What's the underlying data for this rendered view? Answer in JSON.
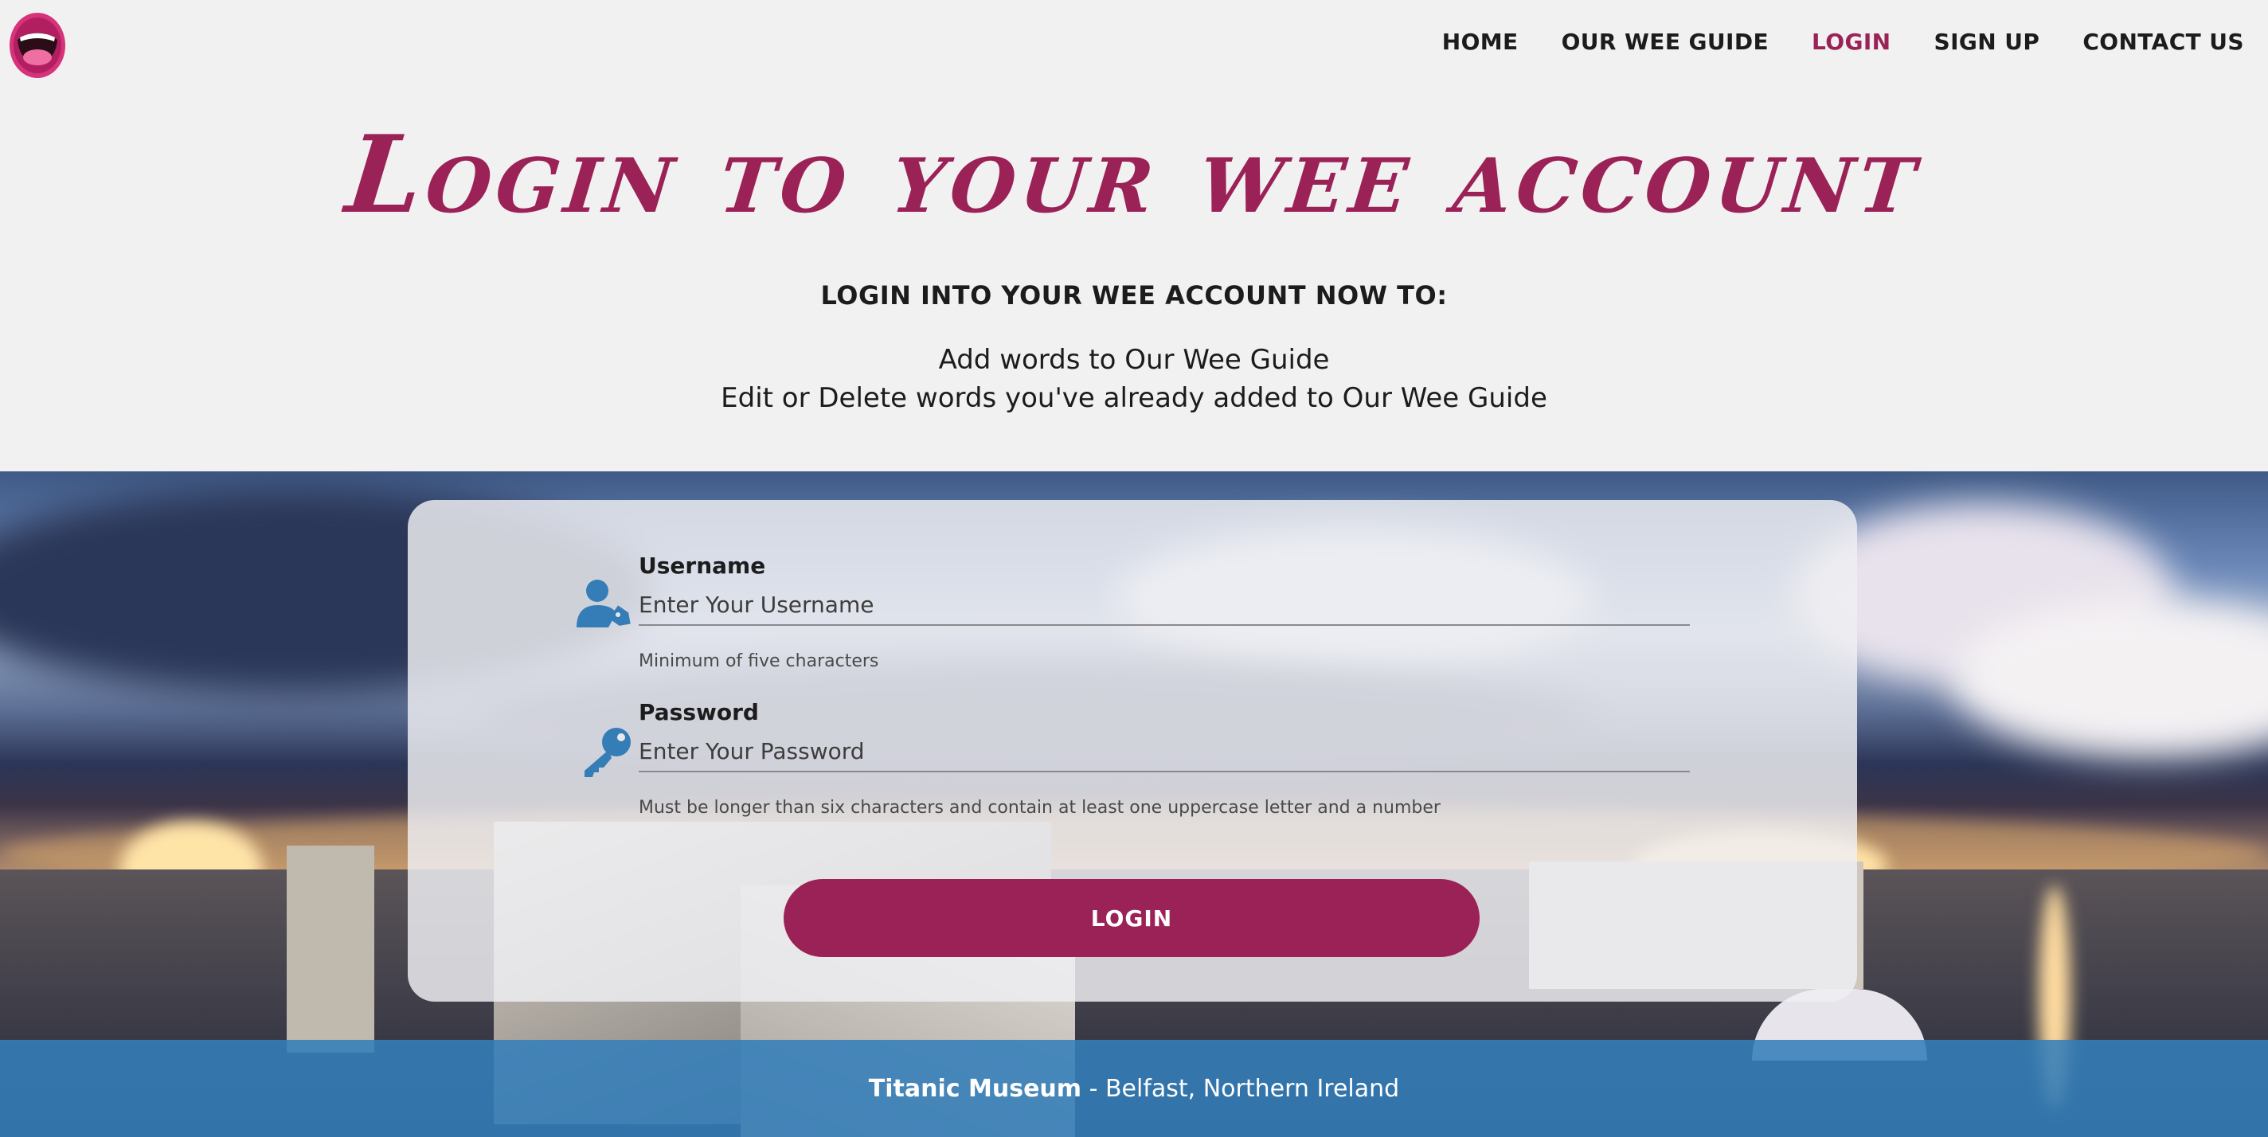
{
  "nav": {
    "items": [
      {
        "label": "HOME",
        "active": false
      },
      {
        "label": "OUR WEE GUIDE",
        "active": false
      },
      {
        "label": "LOGIN",
        "active": true
      },
      {
        "label": "SIGN UP",
        "active": false
      },
      {
        "label": "CONTACT US",
        "active": false
      }
    ]
  },
  "logo": {
    "icon": "open-mouth-logo-icon"
  },
  "intro": {
    "title": "Login to your wee account",
    "subhead": "LOGIN INTO YOUR WEE ACCOUNT NOW TO:",
    "benefits": [
      "Add words to Our Wee Guide",
      "Edit or Delete words you've already added to Our Wee Guide"
    ]
  },
  "form": {
    "username": {
      "label": "Username",
      "placeholder": "Enter Your Username",
      "value": "",
      "hint": "Minimum of five characters",
      "icon": "user-tag-icon"
    },
    "password": {
      "label": "Password",
      "placeholder": "Enter Your Password",
      "value": "",
      "hint": "Must be longer than six characters and contain at least one uppercase letter and a number",
      "icon": "key-icon"
    },
    "submit_label": "LOGIN"
  },
  "caption": {
    "place": "Titanic Museum",
    "separator": " - ",
    "location": "Belfast, Northern Ireland"
  },
  "colors": {
    "brand": "#9b2257",
    "accent_blue": "#347eba",
    "background": "#f2f1f1",
    "text": "#1c1c1c"
  }
}
